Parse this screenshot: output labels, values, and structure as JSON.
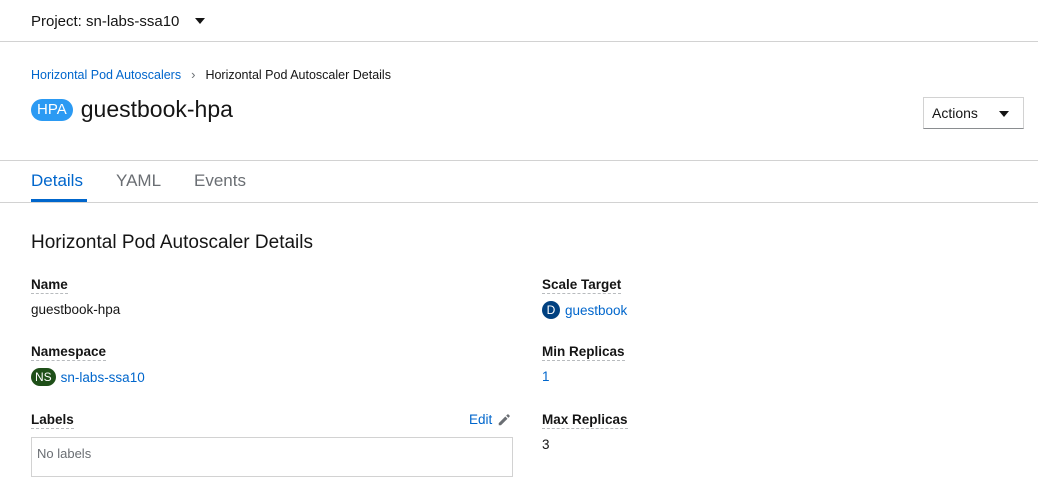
{
  "project_bar": {
    "label": "Project: sn-labs-ssa10"
  },
  "breadcrumb": {
    "parent": "Horizontal Pod Autoscalers",
    "current": "Horizontal Pod Autoscaler Details"
  },
  "header": {
    "badge": "HPA",
    "title": "guestbook-hpa",
    "actions_label": "Actions"
  },
  "tabs": [
    {
      "label": "Details",
      "active": true
    },
    {
      "label": "YAML",
      "active": false
    },
    {
      "label": "Events",
      "active": false
    }
  ],
  "details": {
    "section_title": "Horizontal Pod Autoscaler Details",
    "name": {
      "label": "Name",
      "value": "guestbook-hpa"
    },
    "namespace": {
      "label": "Namespace",
      "badge": "NS",
      "value": "sn-labs-ssa10"
    },
    "labels": {
      "label": "Labels",
      "edit_label": "Edit",
      "empty_text": "No labels"
    },
    "scale_target": {
      "label": "Scale Target",
      "badge": "D",
      "value": "guestbook"
    },
    "min_replicas": {
      "label": "Min Replicas",
      "value": "1"
    },
    "max_replicas": {
      "label": "Max Replicas",
      "value": "3"
    }
  },
  "colors": {
    "link": "#0066cc",
    "hpa_badge": "#2b9af3",
    "ns_badge": "#1e4f18",
    "deployment_badge": "#004080"
  },
  "icons": {
    "project_dropdown": "caret-down-icon",
    "breadcrumb_separator": "chevron-right-icon",
    "actions_dropdown": "caret-down-icon",
    "edit": "pencil-icon"
  }
}
